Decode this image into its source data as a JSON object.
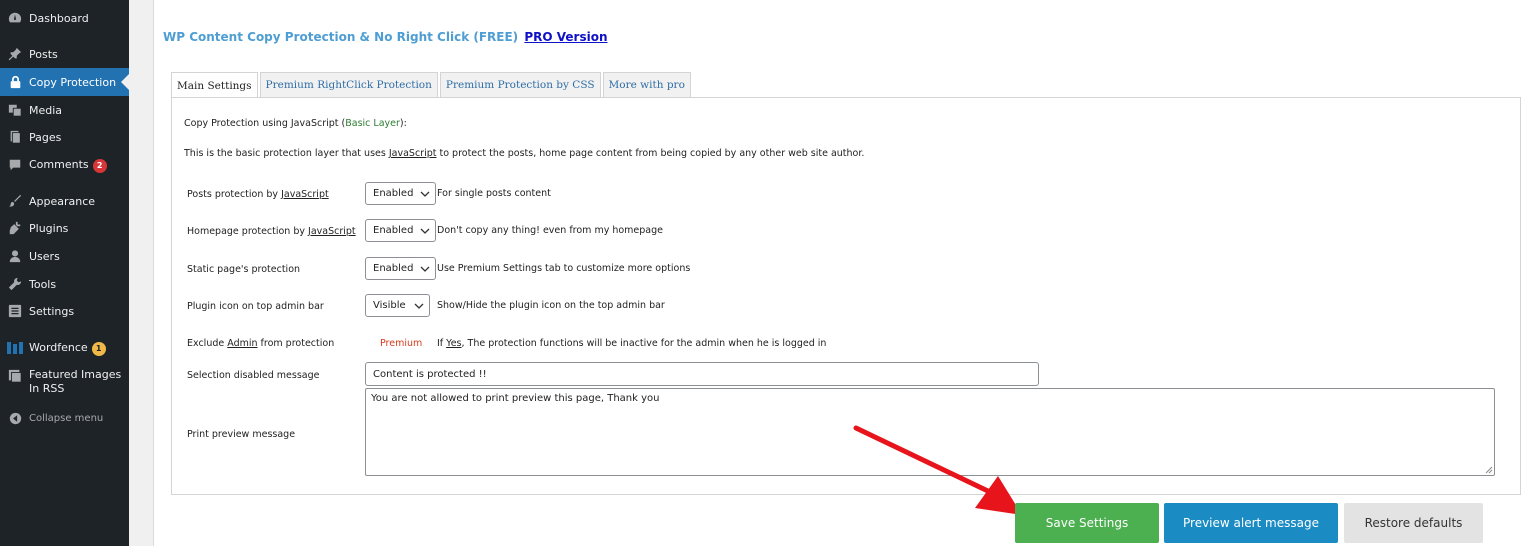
{
  "sidebar": {
    "items": [
      {
        "label": "Dashboard",
        "icon": "dashboard-icon"
      },
      {
        "label": "Posts",
        "icon": "pin-icon"
      },
      {
        "label": "Copy Protection",
        "icon": "lock-icon",
        "active": true
      },
      {
        "label": "Media",
        "icon": "media-icon"
      },
      {
        "label": "Pages",
        "icon": "pages-icon"
      },
      {
        "label": "Comments",
        "icon": "comment-icon",
        "badge": "2"
      },
      {
        "label": "Appearance",
        "icon": "brush-icon"
      },
      {
        "label": "Plugins",
        "icon": "plug-icon"
      },
      {
        "label": "Users",
        "icon": "user-icon"
      },
      {
        "label": "Tools",
        "icon": "wrench-icon"
      },
      {
        "label": "Settings",
        "icon": "settings-icon"
      },
      {
        "label": "Wordfence",
        "icon": "wordfence-icon",
        "badge": "1"
      },
      {
        "label": "Featured Images In RSS",
        "icon": "image-icon"
      },
      {
        "label": "Collapse menu",
        "icon": "collapse-icon"
      }
    ]
  },
  "header": {
    "title": "WP Content Copy Protection & No Right Click (FREE)",
    "pro_link": "PRO Version"
  },
  "tabs": [
    {
      "label": "Main Settings",
      "active": true
    },
    {
      "label": "Premium RightClick Protection"
    },
    {
      "label": "Premium Protection by CSS"
    },
    {
      "label": "More with pro"
    }
  ],
  "panel": {
    "heading": "Copy Protection using JavaScript (",
    "heading_layer": "Basic Layer",
    "heading_end": "):",
    "intro_pre": "This is the basic protection layer that uses ",
    "intro_link": "JavaScript",
    "intro_post": " to protect the posts, home page content from being copied by any other web site author.",
    "rows": {
      "posts": {
        "label_pre": "Posts protection by ",
        "label_link": "JavaScript",
        "value": "Enabled",
        "help": "For single posts content"
      },
      "homepage": {
        "label_pre": "Homepage protection by ",
        "label_link": "JavaScript",
        "value": "Enabled",
        "help": "Don't copy any thing! even from my homepage"
      },
      "static": {
        "label": "Static page's protection",
        "value": "Enabled",
        "help": "Use Premium Settings tab to customize more options"
      },
      "icon": {
        "label": "Plugin icon on top admin bar",
        "value": "Visible",
        "help": "Show/Hide the plugin icon on the top admin bar"
      },
      "exclude": {
        "label_pre": "Exclude ",
        "label_link": "Admin",
        "label_post": " from protection",
        "premium": "Premium",
        "help_pre": "If ",
        "help_link": "Yes",
        "help_post": ", The protection functions will be inactive for the admin when he is logged in"
      },
      "selection": {
        "label": "Selection disabled message",
        "value": "Content is protected !!"
      },
      "print": {
        "label": "Print preview message",
        "value": "You are not allowed to print preview this page, Thank you"
      }
    }
  },
  "buttons": {
    "save": "Save Settings",
    "preview": "Preview alert message",
    "restore": "Restore defaults"
  },
  "colors": {
    "sidebar_bg": "#1d2327",
    "active": "#2271b1",
    "save": "#4caf50",
    "preview": "#1a8bc3",
    "arrow": "#e8141b"
  }
}
